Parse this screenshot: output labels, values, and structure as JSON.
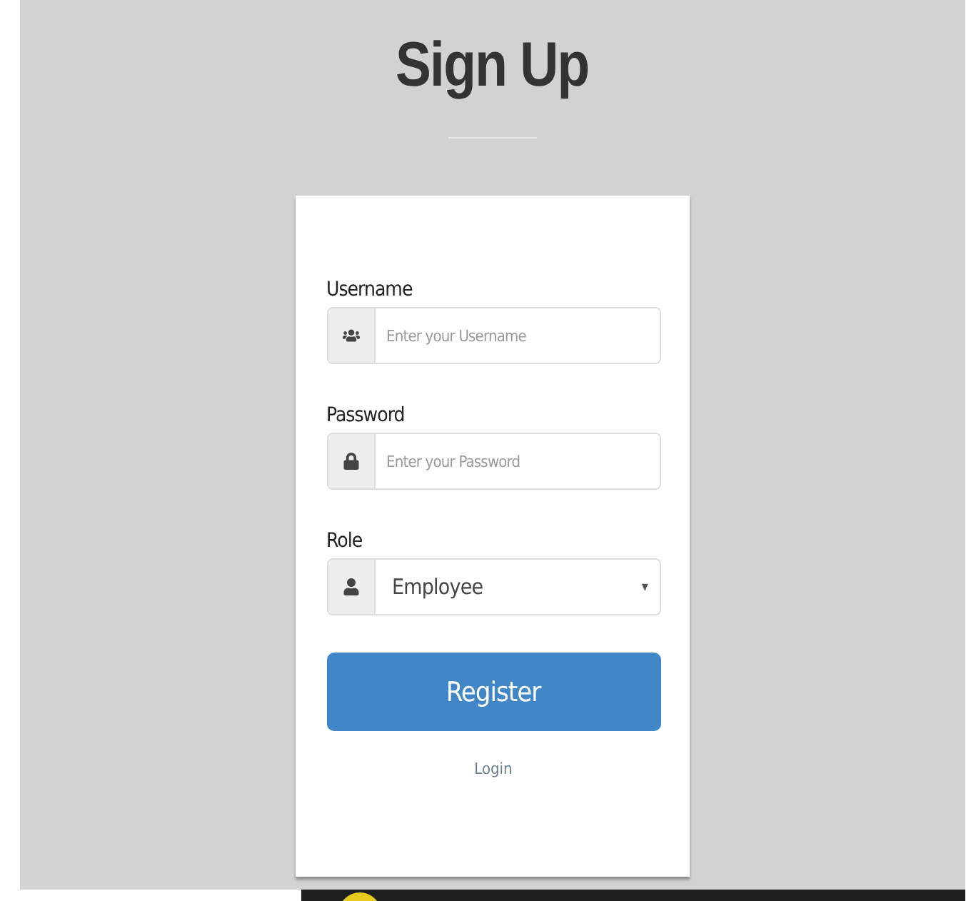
{
  "title": "Sign Up",
  "fields": [
    {
      "kind": "text",
      "label": "Username",
      "placeholder": "Enter your Username"
    },
    {
      "kind": "password",
      "label": "Password",
      "placeholder": "Enter your Password"
    },
    {
      "kind": "select",
      "label": "Role",
      "value": "Employee",
      "caret": "▾"
    }
  ],
  "submit": "Register",
  "link": "Login"
}
